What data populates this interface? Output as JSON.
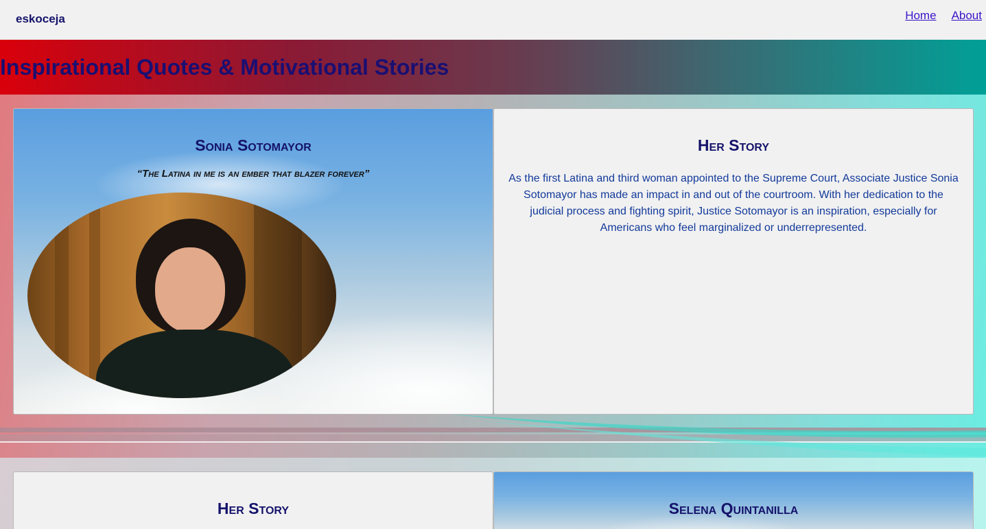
{
  "nav": {
    "brand": "eskoceja",
    "links": [
      "Home",
      "About"
    ]
  },
  "header": {
    "title": "Inspirational Quotes & Motivational Stories"
  },
  "sections": [
    {
      "person": "Sonia Sotomayor",
      "quote": "“The Latina in me is an ember that blazer forever”",
      "story_title": "Her Story",
      "story": "As the first Latina and third woman appointed to the Supreme Court, Associate Justice Sonia Sotomayor has made an impact in and out of the courtroom. With her dedication to the judicial process and fighting spirit, Justice Sotomayor is an inspiration, especially for Americans who feel marginalized or underrepresented."
    },
    {
      "story_title": "Her Story",
      "person": "Selena Quintanilla"
    }
  ],
  "colors": {
    "heading": "#14126a",
    "link": "#3a14c9",
    "story_text": "#12399a",
    "banner_start": "#d9000b",
    "banner_end": "#00a097"
  }
}
